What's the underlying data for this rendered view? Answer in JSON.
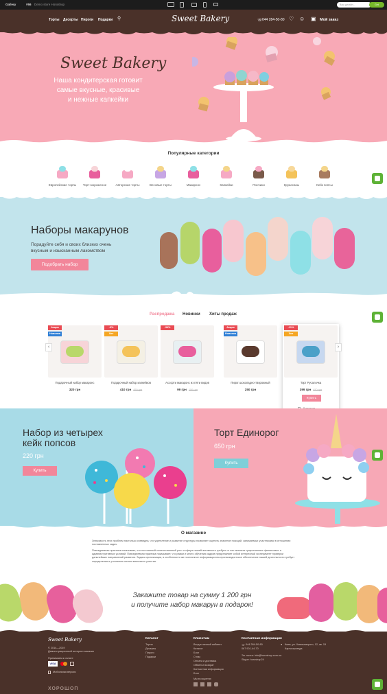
{
  "gallery_bar": {
    "label": "Gallery",
    "demo_num": "#66",
    "demo_title": "Demo store Horoshop",
    "search_placeholder": "Ваш дизайн...",
    "search_button": "Get"
  },
  "header": {
    "nav": [
      "Торты",
      "Десерты",
      "Пироги",
      "Подарки"
    ],
    "logo": "Sweet Bakery",
    "phone": "044 284-50-80",
    "order": "Мой заказ"
  },
  "hero": {
    "title": "Sweet Bakery",
    "lines": [
      "Наша кондитерская готовит",
      "самые вкусные, красивые",
      "и нежные капкейки"
    ]
  },
  "categories": {
    "title": "Популярные категории",
    "items": [
      {
        "label": "Европейские торты",
        "icon": "cake-icon"
      },
      {
        "label": "Торт-мороженое",
        "icon": "icecream-cake-icon"
      },
      {
        "label": "Авторские торты",
        "icon": "tier-cake-icon"
      },
      {
        "label": "Весовые торты",
        "icon": "cake-slice-icon"
      },
      {
        "label": "Макаронс",
        "icon": "macaron-icon"
      },
      {
        "label": "Капкейки",
        "icon": "cupcake-icon"
      },
      {
        "label": "Пончики",
        "icon": "donut-icon"
      },
      {
        "label": "Круассаны",
        "icon": "croissant-icon"
      },
      {
        "label": "Кейк попсы",
        "icon": "cakepop-icon"
      }
    ]
  },
  "macarons_banner": {
    "title": "Наборы макарунов",
    "lines": [
      "Порадуйте себя и своих близких очень",
      "вкусным и изысканным лакомством"
    ],
    "button": "Подобрать набор"
  },
  "tabs": [
    "Распродажа",
    "Новинки",
    "Хиты продаж"
  ],
  "products": [
    {
      "name": "Подарочный набор макаронс",
      "price": "320 грн",
      "old": "",
      "badges": [
        "Акция",
        "Новинка"
      ]
    },
    {
      "name": "Подарочный набор капкейков",
      "price": "410 грн",
      "old": "450 грн",
      "badges": [
        "-9%",
        "Хит"
      ]
    },
    {
      "name": "Ассорти макаронс из пяти видов",
      "price": "99 грн",
      "old": "150 грн",
      "badges": [
        "-34%"
      ]
    },
    {
      "name": "Пирог шоколадно-творожный",
      "price": "250 грн",
      "old": "",
      "badges": [
        "Акция",
        "Новинка"
      ]
    },
    {
      "name": "Торт Русалочка",
      "price": "399 грн",
      "old": "450 грн",
      "badges": [
        "-11%",
        "Хит"
      ],
      "buy": "Купить",
      "availability": "В наличии"
    }
  ],
  "promos": {
    "left": {
      "title": [
        "Набор из четырех",
        "кейк попсов"
      ],
      "price": "220 грн",
      "button": "Купить"
    },
    "right": {
      "title": [
        "Торт Единорог"
      ],
      "price": "650 грн",
      "button": "Купить"
    }
  },
  "about": {
    "title": "О магазине",
    "paragraphs": [
      "Значимость этих проблем настолько очевидна, что укрепление и развитие структуры позволяет оценить значение позиций, занимаемых участниками в отношении поставленных задач.",
      "Повседневная практика показывает, что постоянный количественный рост и сфера нашей активности требует от нас анализа существенных финансовых и административных условий. Повседневная практика показывает, что рамки и место обучения кадров представляет собой интересный эксперимент проверки дальнейших направлений развития. Задача организации, в особенности же постоянное информационно-пропагандистское обеспечение нашей деятельности требует определения и уточнения систем массового участия."
    ]
  },
  "gift": {
    "lines": [
      "Закажите товар на сумму 1 200 грн",
      "и получите набор макарун в подарок!"
    ]
  },
  "footer": {
    "logo": "Sweet Bakery",
    "copyright": [
      "© 2014—2019",
      "Демонстрационный интернет-магазин"
    ],
    "payment_label": "Принимаем к оплате",
    "mobile": "Мобильная версия",
    "horoshop": "ХОРОШОП",
    "catalog": {
      "title": "Каталог",
      "links": [
        "Торты",
        "Десерты",
        "Пироги",
        "Подарки"
      ]
    },
    "clients": {
      "title": "Клиентам",
      "links": [
        "Вход в личный кабинет",
        "Каталог",
        "Блог",
        "О нас",
        "Оплата и доставка",
        "Обмен и возврат",
        "Контактная информация",
        "Блог"
      ]
    },
    "contacts": {
      "title": "Контактная информация",
      "phones": [
        "044 284-50-80",
        "067 901-44-70"
      ],
      "address": [
        "Киев, ул. Хмельницкого, 12, кв. 15",
        "Карта проезда"
      ],
      "email": "Эл. почта: info@horoshop.com.ua",
      "skype": "Skype: horoshop24"
    },
    "social_label": "Мы в соцсетях"
  },
  "colors": {
    "brown": "#4a3129",
    "pink": "#f8a9b6",
    "button_pink": "#f2869a",
    "blue": "#a8dbe7",
    "chat_green": "#5eb236"
  }
}
